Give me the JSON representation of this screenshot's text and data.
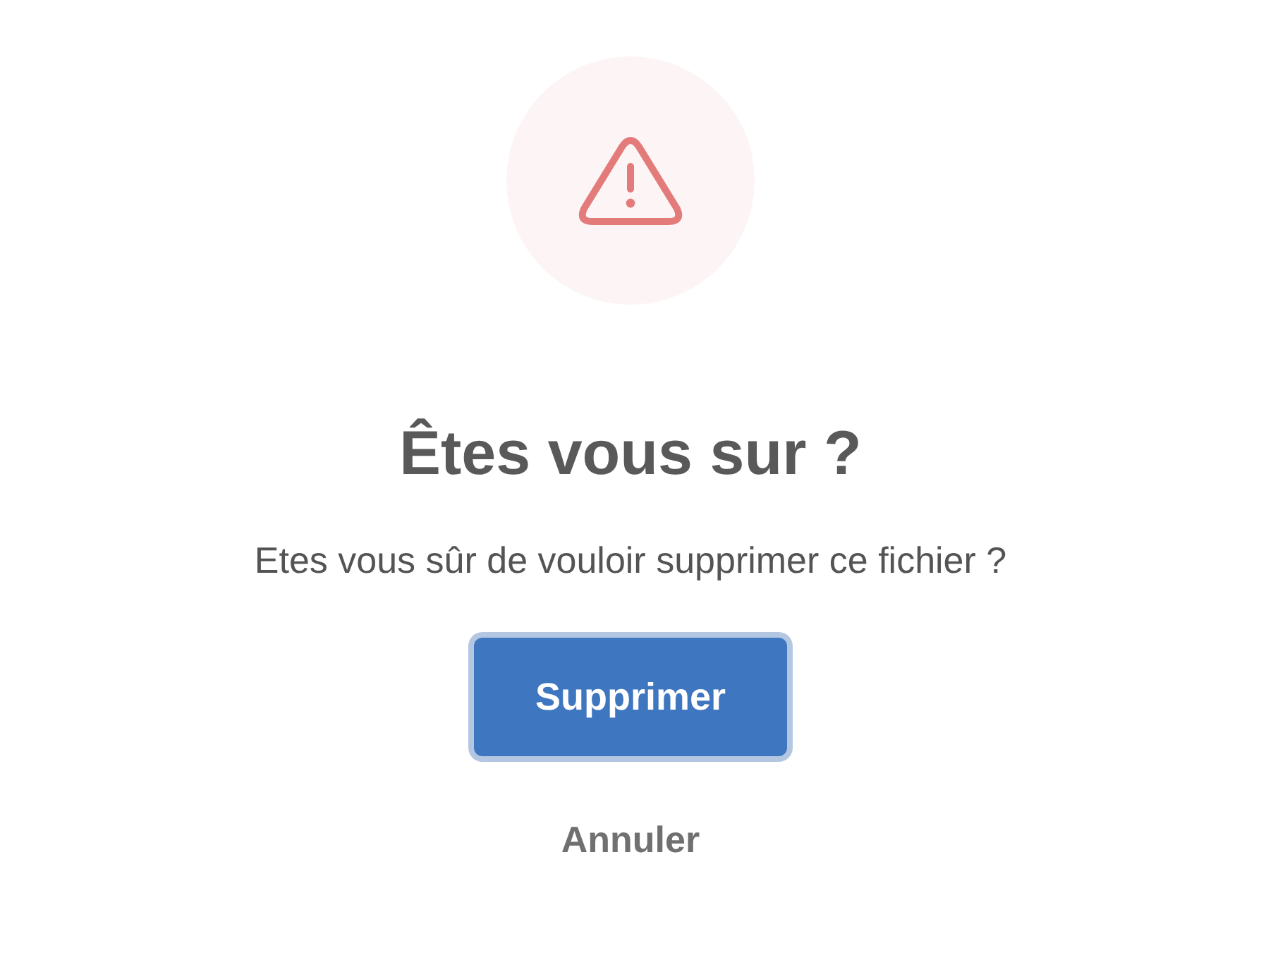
{
  "icon": {
    "kind": "warning"
  },
  "title": "Êtes vous sur ?",
  "message": "Etes vous sûr de vouloir supprimer ce fichier ?",
  "confirm_button": {
    "label": "Supprimer",
    "focused": true
  },
  "cancel_button": {
    "label": "Annuler"
  }
}
